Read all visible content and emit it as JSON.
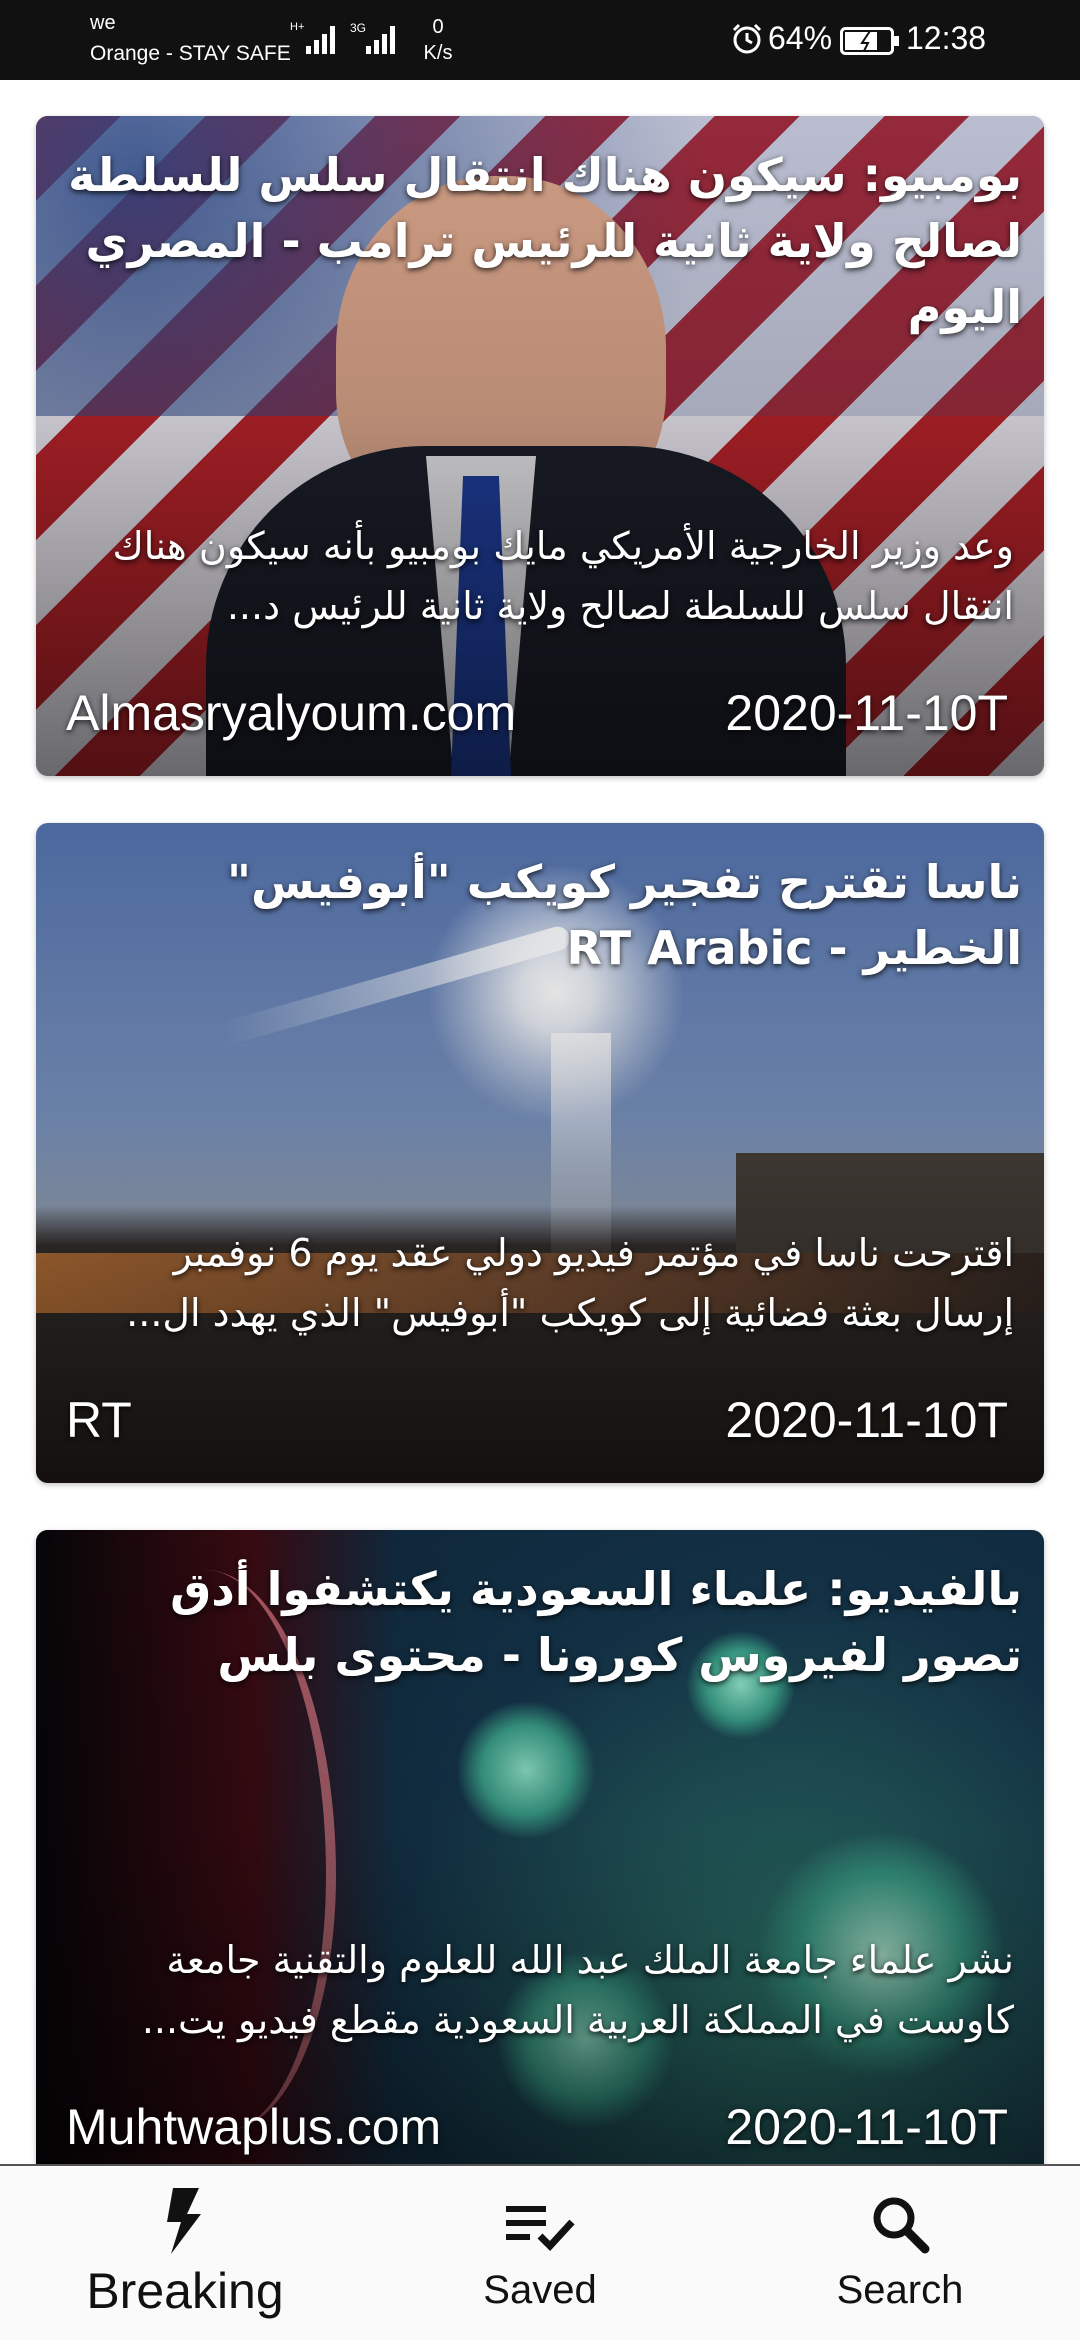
{
  "status_bar": {
    "carrier_top": "we",
    "carrier": "Orange - STAY SAFE",
    "net_type_1": "H+",
    "net_type_2": "3G",
    "speed_value": "0",
    "speed_unit": "K/s",
    "battery_percent": "64%",
    "time": "12:38"
  },
  "articles": [
    {
      "title": "بومبيو: سيكون هناك انتقال سلس للسلطة لصالح ولاية ثانية للرئيس ترامب - المصري اليوم",
      "description": "وعد وزير الخارجية الأمريكي مايك بومبيو بأنه سيكون هناك انتقال سلس للسلطة لصالح ولاية ثانية للرئيس د...",
      "source": "Almasryalyoum.com",
      "date": "2020-11-10T"
    },
    {
      "title": "ناسا تقترح تفجير كويكب \"أبوفيس\" الخطير - RT Arabic",
      "description": "اقترحت ناسا في مؤتمر فيديو دولي عقد يوم 6 نوفمبر إرسال بعثة فضائية إلى كويكب \"أبوفيس\" الذي يهدد ال...",
      "source": "RT",
      "date": "2020-11-10T"
    },
    {
      "title": "بالفيديو: علماء السعودية يكتشفوا أدق تصور لفيروس كورونا - محتوى بلس",
      "description": "نشر علماء جامعة الملك عبد الله للعلوم والتقنية جامعة كاوست في المملكة العربية السعودية مقطع فيديو يت...",
      "source": "Muhtwaplus.com",
      "date": "2020-11-10T"
    }
  ],
  "bottom_nav": {
    "items": [
      {
        "label": "Breaking",
        "icon": "lightning-icon",
        "active": true
      },
      {
        "label": "Saved",
        "icon": "saved-list-icon",
        "active": false
      },
      {
        "label": "Search",
        "icon": "search-icon",
        "active": false
      }
    ]
  }
}
